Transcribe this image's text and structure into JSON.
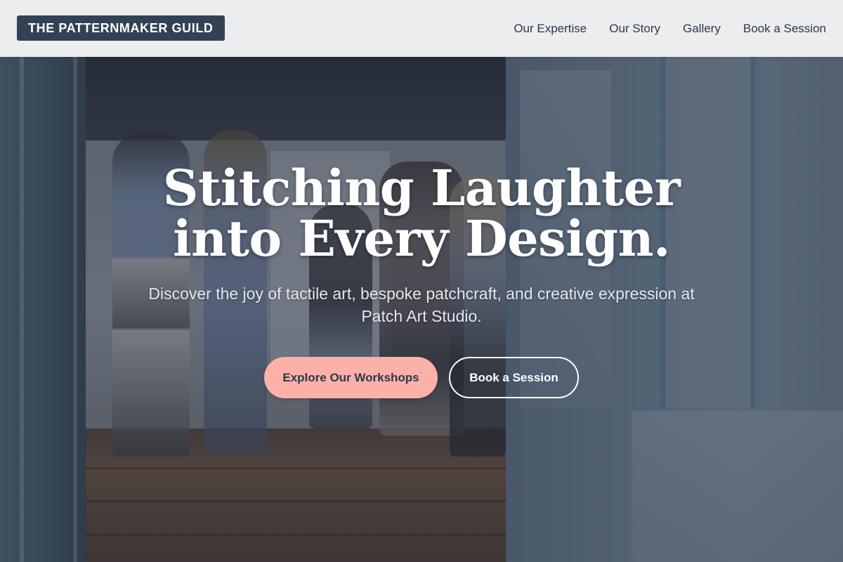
{
  "header": {
    "logo_text": "THE PATTERNMAKER GUILD",
    "nav": [
      {
        "label": "Our Expertise"
      },
      {
        "label": "Our Story"
      },
      {
        "label": "Gallery"
      },
      {
        "label": "Book a Session"
      }
    ]
  },
  "hero": {
    "title": "Stitching Laughter into Every Design.",
    "subtitle": "Discover the joy of tactile art, bespoke patchcraft, and creative expression at Patch Art Studio.",
    "primary_cta": "Explore Our Workshops",
    "secondary_cta": "Book a Session"
  },
  "colors": {
    "logo_bg": "#334155",
    "header_bg": "#f3f4f6",
    "primary_button": "#fbb1a8",
    "text_dark": "#2d3748"
  }
}
